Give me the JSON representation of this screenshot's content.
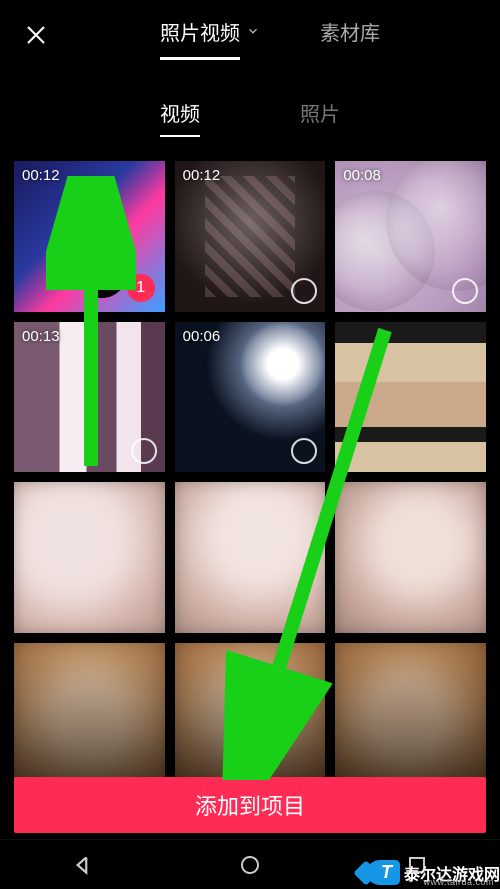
{
  "header": {
    "tab_primary": "照片视频",
    "tab_secondary": "素材库"
  },
  "subtabs": {
    "video": "视频",
    "photo": "照片"
  },
  "grid": {
    "items": [
      {
        "duration": "00:12",
        "selected_index": "1"
      },
      {
        "duration": "00:12"
      },
      {
        "duration": "00:08"
      },
      {
        "duration": "00:13"
      },
      {
        "duration": "00:06"
      },
      {
        "duration": ""
      },
      {
        "duration": ""
      },
      {
        "duration": ""
      },
      {
        "duration": ""
      },
      {
        "duration": ""
      },
      {
        "duration": ""
      },
      {
        "duration": ""
      }
    ]
  },
  "primary_button": "添加到项目",
  "watermark": {
    "badge": "T",
    "name": "泰尔达游戏网",
    "url": "www.tairda.com"
  }
}
